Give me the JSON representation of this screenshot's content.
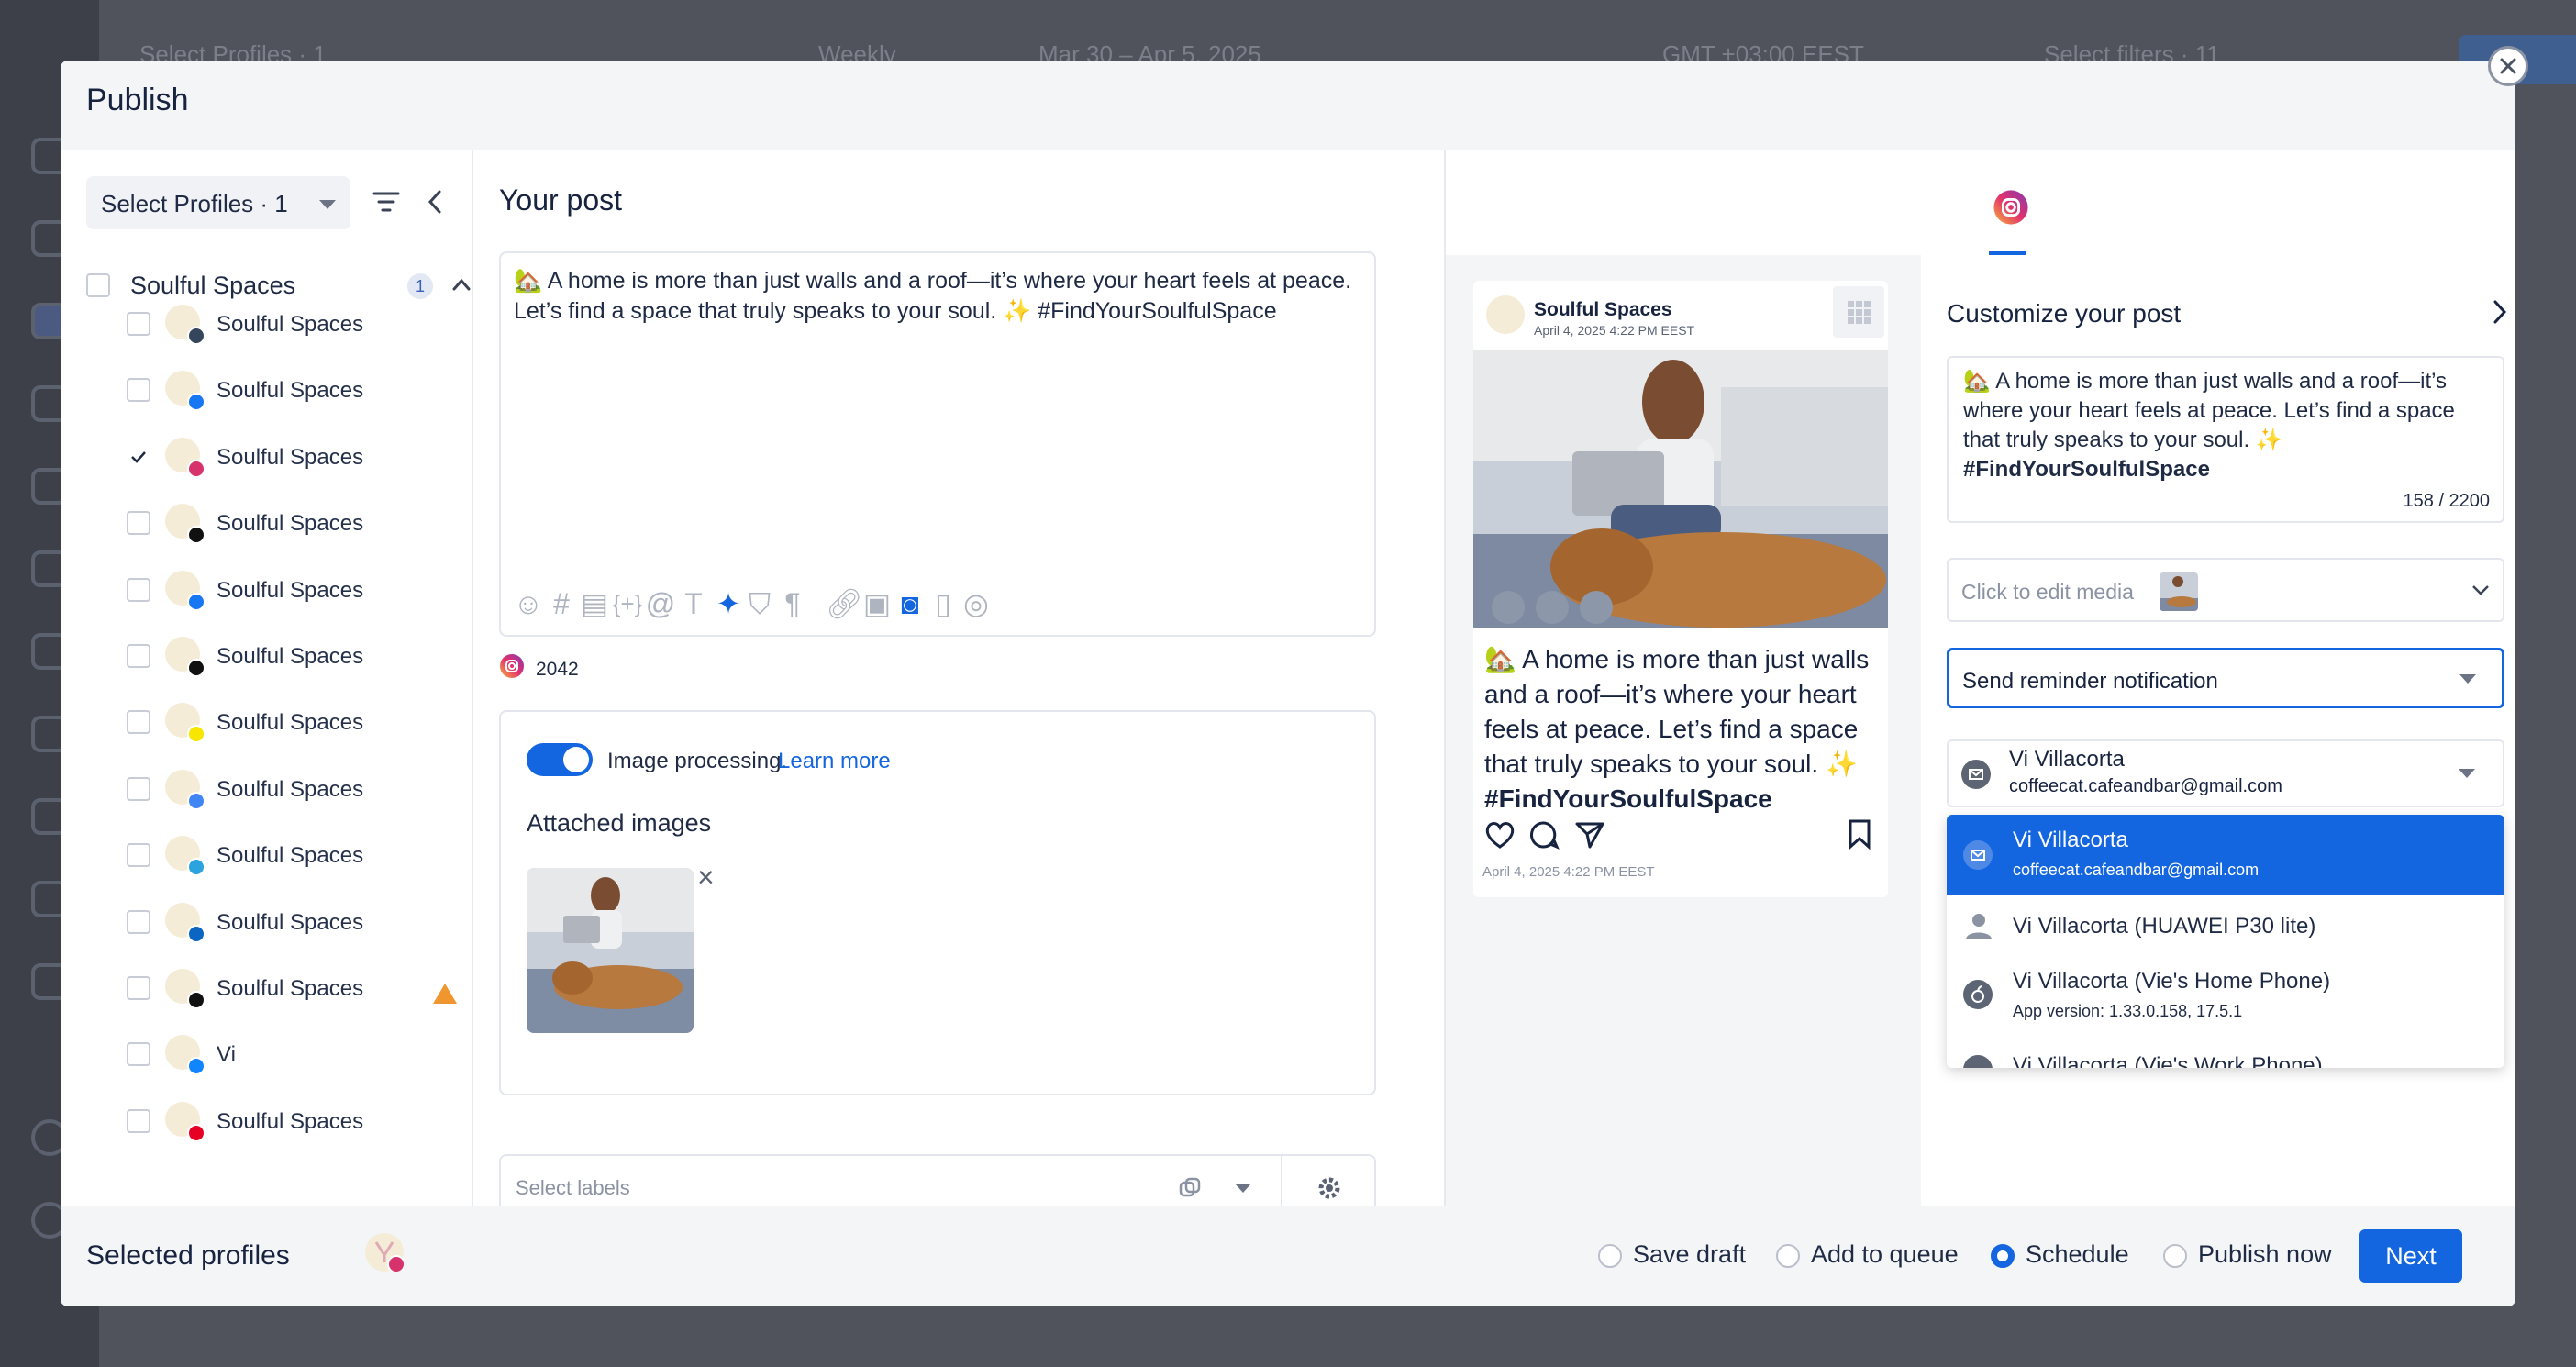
{
  "background": {
    "toolbar_items": [
      "Select Profiles · 1",
      "Weekly",
      "Mar 30 – Apr 5, 2025",
      "GMT +03:00 EEST",
      "Select filters · 11"
    ]
  },
  "modal": {
    "title": "Publish",
    "close_icon": "close-icon"
  },
  "left": {
    "profile_select_label": "Select Profiles · 1",
    "group": {
      "label": "Soulful Spaces",
      "count": "1"
    },
    "profiles": [
      {
        "name": "Soulful Spaces",
        "network": "tumblr",
        "checked": false
      },
      {
        "name": "Soulful Spaces",
        "network": "facebook",
        "checked": false
      },
      {
        "name": "Soulful Spaces",
        "network": "instagram",
        "checked": true
      },
      {
        "name": "Soulful Spaces",
        "network": "x",
        "checked": false
      },
      {
        "name": "Soulful Spaces",
        "network": "facebook",
        "checked": false
      },
      {
        "name": "Soulful Spaces",
        "network": "tiktok",
        "checked": false
      },
      {
        "name": "Soulful Spaces",
        "network": "snapchat",
        "checked": false
      },
      {
        "name": "Soulful Spaces",
        "network": "google-business",
        "checked": false
      },
      {
        "name": "Soulful Spaces",
        "network": "telegram",
        "checked": false
      },
      {
        "name": "Soulful Spaces",
        "network": "linkedin",
        "checked": false
      },
      {
        "name": "Soulful Spaces",
        "network": "threads",
        "checked": false,
        "warning": true
      },
      {
        "name": "Vi",
        "network": "bluesky",
        "checked": false
      },
      {
        "name": "Soulful Spaces",
        "network": "pinterest",
        "checked": false
      }
    ]
  },
  "post": {
    "title": "Your post",
    "text_line1": "🏡 A home is more than just walls and a roof—it’s where your heart feels at peace.",
    "text_line2": "Let’s find a space that truly speaks to your soul. ✨ #FindYourSoulfulSpace",
    "char_remaining": "2042",
    "image_processing_label": "Image processing.",
    "learn_more": "Learn more",
    "attached_images_title": "Attached images",
    "labels_placeholder": "Select labels"
  },
  "preview": {
    "account_name": "Soulful Spaces",
    "date_top": "April 4, 2025 4:22 PM EEST",
    "caption": "🏡 A home is more than just walls and a roof—it’s where your heart feels at peace. Let’s find a space that truly speaks to your soul. ✨",
    "hashtag": "#FindYourSoulfulSpace",
    "date_bottom": "April 4, 2025 4:22 PM EEST"
  },
  "customize": {
    "title": "Customize your post",
    "caption": "🏡 A home is more than just walls and a roof—it’s where your heart feels at peace. Let’s find a space that truly speaks to your soul. ✨",
    "hashtag": "#FindYourSoulfulSpace",
    "char_count": "158 / 2200",
    "media_label": "Click to edit media",
    "reminder_label": "Send reminder notification",
    "selected_user_name": "Vi Villacorta",
    "selected_user_email": "coffeecat.cafeandbar@gmail.com",
    "dropdown_options": [
      {
        "title": "Vi Villacorta",
        "subtitle": "coffeecat.cafeandbar@gmail.com",
        "icon": "mail-icon",
        "selected": true
      },
      {
        "title": "Vi Villacorta (HUAWEI P30 lite)",
        "subtitle": "",
        "icon": "person-icon",
        "selected": false
      },
      {
        "title": "Vi Villacorta (Vie's Home Phone)",
        "subtitle": "App version: 1.33.0.158, 17.5.1",
        "icon": "apple-icon",
        "selected": false
      },
      {
        "title": "Vi Villacorta (Vie's Work Phone)",
        "subtitle": "",
        "icon": "apple-icon",
        "selected": false
      }
    ]
  },
  "footer": {
    "title": "Selected profiles",
    "options": [
      "Save draft",
      "Add to queue",
      "Schedule",
      "Publish now"
    ],
    "selected_option": "Schedule",
    "next_label": "Next"
  },
  "colors": {
    "accent": "#1466e0",
    "warning": "#f0962e",
    "instagram": "#c13584"
  }
}
